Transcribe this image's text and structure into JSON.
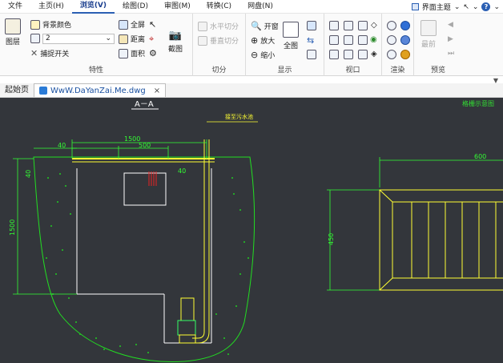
{
  "menu": {
    "items": [
      {
        "label": "文件"
      },
      {
        "label": "主页(H)"
      },
      {
        "label": "浏览(V)",
        "active": true
      },
      {
        "label": "绘图(D)"
      },
      {
        "label": "审图(M)"
      },
      {
        "label": "转换(C)"
      },
      {
        "label": "网盘(N)"
      }
    ],
    "theme_label": "界面主题"
  },
  "ribbon": {
    "texiang": {
      "layer_label": "图层",
      "bgcolor_label": "背景颜色",
      "layer_value": "2",
      "snap_label": "捕捉开关",
      "fullscreen_label": "全屏",
      "distance_label": "距离",
      "area_label": "面积",
      "screenshot_label": "截图",
      "group_label": "特性"
    },
    "qiefen": {
      "h_split_label": "水平切分",
      "v_split_label": "垂直切分",
      "group_label": "切分"
    },
    "xianshi": {
      "open_window_label": "开窗",
      "zoom_in_label": "放大",
      "zoom_out_label": "缩小",
      "full_view_label": "全图",
      "group_label": "显示"
    },
    "shikou": {
      "group_label": "视口"
    },
    "xuanran": {
      "group_label": "渲染"
    },
    "yulan": {
      "latest_label": "最前",
      "group_label": "预览"
    }
  },
  "tabs": {
    "start_label": "起始页",
    "file_label": "WwW.DaYanZai.Me.dwg"
  },
  "drawing": {
    "section_title": "A－A",
    "pipe_label": "接至污水池",
    "right_title": "格栅示意图",
    "dims": {
      "top_total": "1500",
      "top_inner": "500",
      "left_offset": "40",
      "wall_depth": "40",
      "inner_gap": "40",
      "height": "1500",
      "right_width": "600",
      "right_height": "450"
    }
  }
}
